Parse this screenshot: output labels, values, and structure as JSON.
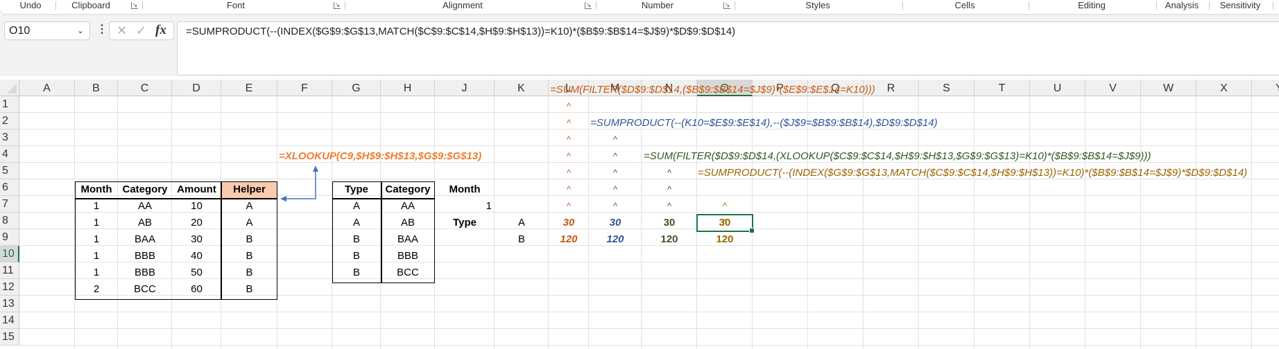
{
  "ribbon": {
    "groups": [
      "Undo",
      "Clipboard",
      "Font",
      "Alignment",
      "Number",
      "Styles",
      "Cells",
      "Editing",
      "Analysis",
      "Sensitivity"
    ]
  },
  "formula_bar": {
    "name_box": "O10",
    "cancel_icon": "✕",
    "enter_icon": "✓",
    "fx_label": "fx",
    "formula": "=SUMPRODUCT(--(INDEX($G$9:$G$13,MATCH($C$9:$C$14,$H$9:$H$13))=K10)*($B$9:$B$14=$J$9)*$D$9:$D$14)"
  },
  "grid": {
    "columns": [
      "A",
      "B",
      "C",
      "D",
      "E",
      "F",
      "G",
      "H",
      "J",
      "K",
      "L",
      "M",
      "N",
      "O",
      "P",
      "Q",
      "R",
      "S",
      "T",
      "U",
      "V",
      "W",
      "X",
      "Y"
    ],
    "selected_column": "O",
    "rows": [
      "1",
      "2",
      "3",
      "4",
      "5",
      "6",
      "7",
      "8",
      "9",
      "10",
      "11",
      "12",
      "13",
      "14",
      "15"
    ],
    "selected_row": "10"
  },
  "data_table": {
    "headers": [
      "Month",
      "Category",
      "Amount",
      "Helper"
    ],
    "rows": [
      [
        "1",
        "AA",
        "10",
        "A"
      ],
      [
        "1",
        "AB",
        "20",
        "A"
      ],
      [
        "1",
        "BAA",
        "30",
        "B"
      ],
      [
        "1",
        "BBB",
        "40",
        "B"
      ],
      [
        "1",
        "BBB",
        "50",
        "B"
      ],
      [
        "2",
        "BCC",
        "60",
        "B"
      ]
    ],
    "helper_header_color": "#f8cbad"
  },
  "lookup_table": {
    "headers": [
      "Type",
      "Category"
    ],
    "rows": [
      [
        "A",
        "AA"
      ],
      [
        "A",
        "AB"
      ],
      [
        "B",
        "BAA"
      ],
      [
        "B",
        "BBB"
      ],
      [
        "B",
        "BCC"
      ]
    ]
  },
  "criteria": {
    "month_label": "Month",
    "month_value": "1",
    "type_label": "Type",
    "types": [
      "A",
      "B"
    ]
  },
  "annotations": {
    "xlookup_formula": "=XLOOKUP(C9,$H$9:$H$13,$G$9:$G$13)",
    "formula_L": "=SUM(FILTER($D$9:$D$14,($B$9:$B$14=$J$9)*($E$9:$E$14=K10)))",
    "formula_M": "=SUMPRODUCT(--(K10=$E$9:$E$14),--($J$9=$B$9:$B$14),$D$9:$D$14)",
    "formula_N": "=SUM(FILTER($D$9:$D$14,(XLOOKUP($C$9:$C$14,$H$9:$H$13,$G$9:$G$13)=K10)*($B$9:$B$14=$J$9)))",
    "formula_O": "=SUMPRODUCT(--(INDEX($G$9:$G$13,MATCH($C$9:$C$14,$H$9:$H$13))=K10)*($B$9:$B$14=$J$9)*$D$9:$D$14)",
    "caret": "^"
  },
  "results": {
    "L": [
      "30",
      "120"
    ],
    "M": [
      "30",
      "120"
    ],
    "N": [
      "30",
      "120"
    ],
    "O": [
      "30",
      "120"
    ]
  },
  "colors": {
    "orange": "#c65911",
    "xlookup_orange": "#ed7d31",
    "blue": "#2f5597",
    "green": "#375623",
    "gold": "#9c6500",
    "selection": "#1e7145"
  }
}
